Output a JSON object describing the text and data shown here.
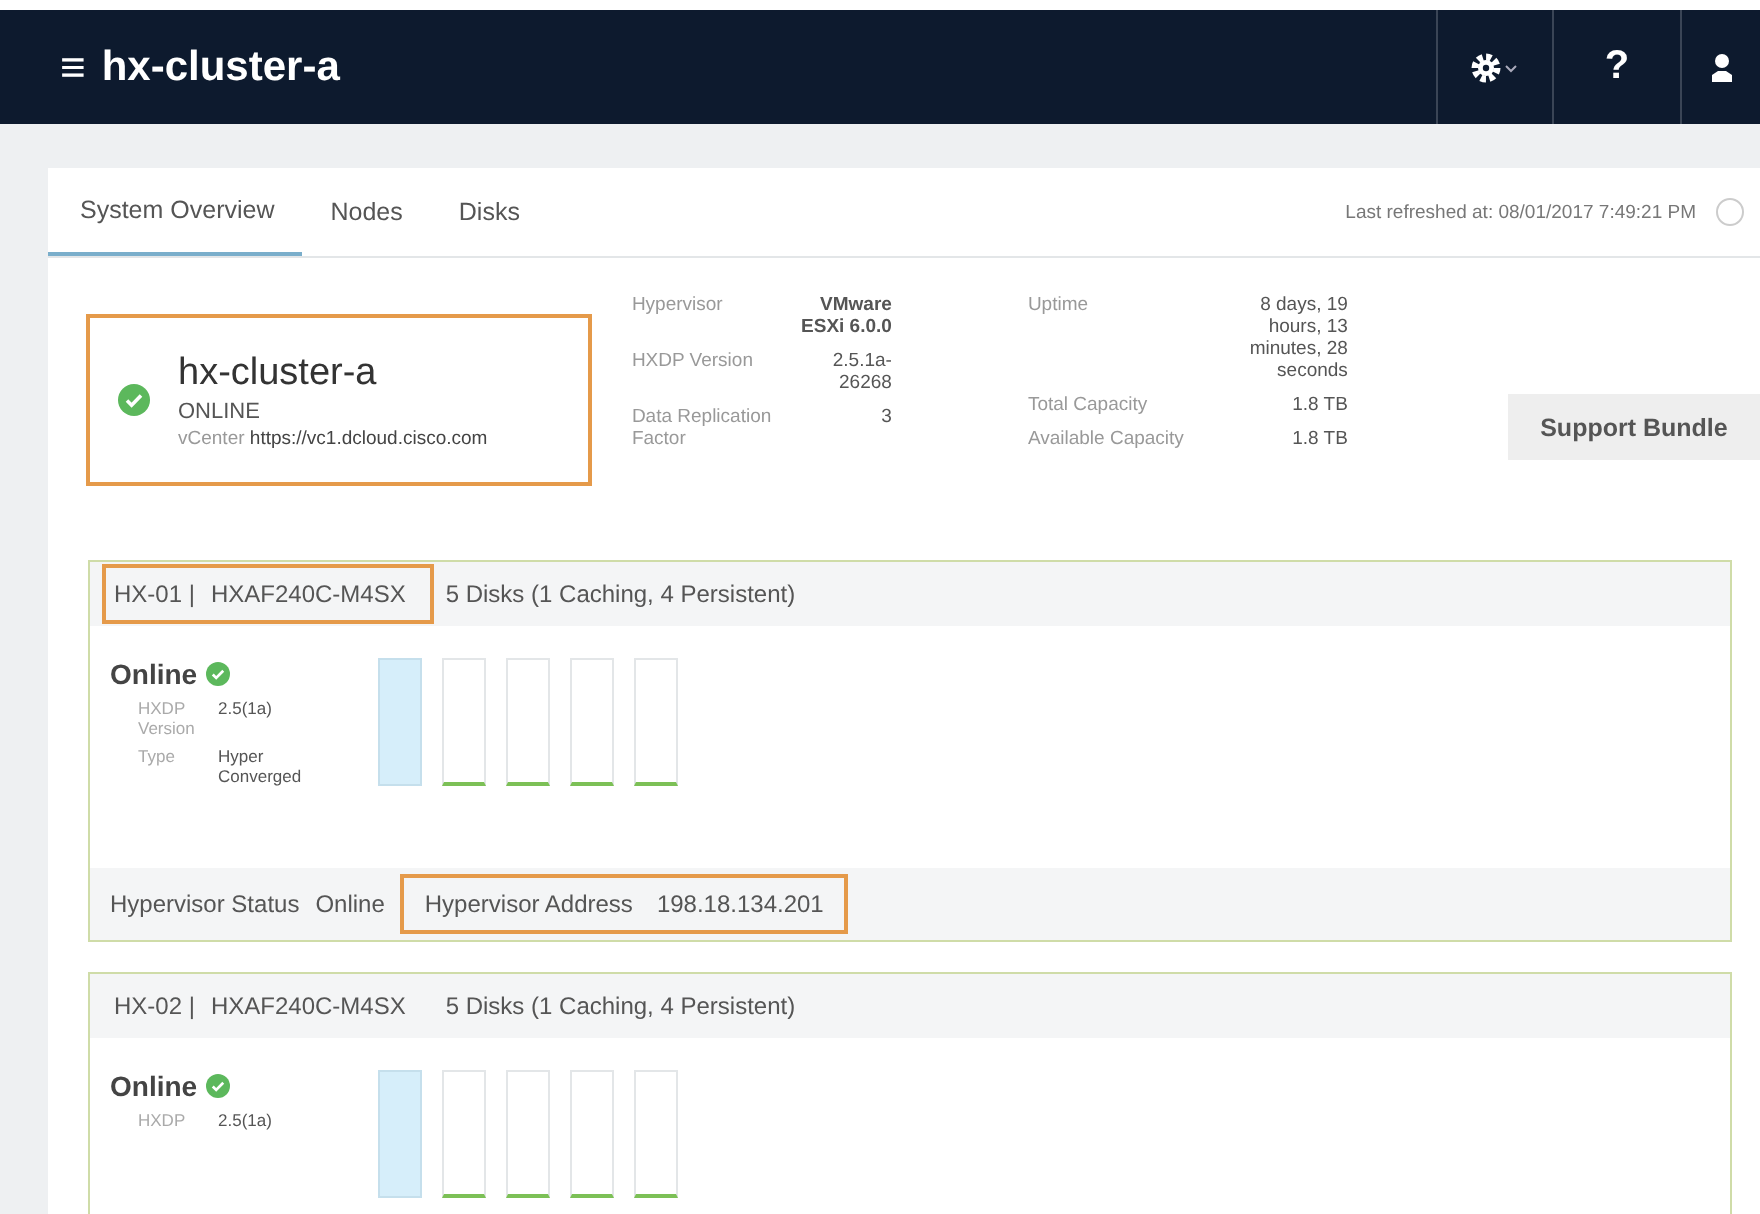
{
  "header": {
    "menu_glyph": "≡",
    "title": "hx-cluster-a",
    "help_glyph": "?"
  },
  "tabs": [
    {
      "label": "System Overview",
      "selected": true
    },
    {
      "label": "Nodes",
      "selected": false
    },
    {
      "label": "Disks",
      "selected": false
    }
  ],
  "last_refreshed": "Last refreshed at: 08/01/2017 7:49:21 PM",
  "cluster": {
    "name": "hx-cluster-a",
    "status": "ONLINE",
    "healthy": true,
    "highlighted": true,
    "vcenter_label": "vCenter",
    "vcenter": "https://vc1.dcloud.cisco.com"
  },
  "details": [
    [
      {
        "label": "Hypervisor",
        "value": "VMware ESXi 6.0.0",
        "bold": true
      },
      {
        "label": "HXDP Version",
        "value": "2.5.1a-26268",
        "bold": false
      },
      {
        "label": "Data Replication Factor",
        "value": "3",
        "bold": false
      }
    ],
    [
      {
        "label": "Uptime",
        "value": "8 days, 19 hours, 13 minutes, 28 seconds",
        "bold": false
      },
      {
        "label": "Total Capacity",
        "value": "1.8 TB",
        "bold": false
      },
      {
        "label": "Available Capacity",
        "value": "1.8 TB",
        "bold": false
      }
    ]
  ],
  "support_button": "Support Bundle",
  "nodes": [
    {
      "id": "HX-01 |",
      "model": "HXAF240C-M4SX",
      "highlighted": true,
      "disks_summary": "5 Disks (1 Caching, 4 Persistent)",
      "status": "Online",
      "healthy": true,
      "info": [
        {
          "label": "HXDP Version",
          "value": "2.5(1a)"
        },
        {
          "label": "Type",
          "value": "Hyper Converged"
        }
      ],
      "disks": [
        {
          "kind": "caching"
        },
        {
          "kind": "persistent"
        },
        {
          "kind": "persistent"
        },
        {
          "kind": "persistent"
        },
        {
          "kind": "persistent"
        }
      ],
      "footer": {
        "status_label": "Hypervisor Status",
        "status": "Online",
        "address_label": "Hypervisor Address",
        "address": "198.18.134.201",
        "address_highlighted": true
      }
    },
    {
      "id": "HX-02 |",
      "model": "HXAF240C-M4SX",
      "highlighted": false,
      "disks_summary": "5 Disks (1 Caching, 4 Persistent)",
      "status": "Online",
      "healthy": true,
      "info": [
        {
          "label": "HXDP",
          "value": "2.5(1a)"
        }
      ],
      "disks": [
        {
          "kind": "caching"
        },
        {
          "kind": "persistent"
        },
        {
          "kind": "persistent"
        },
        {
          "kind": "persistent"
        },
        {
          "kind": "persistent"
        }
      ]
    }
  ]
}
